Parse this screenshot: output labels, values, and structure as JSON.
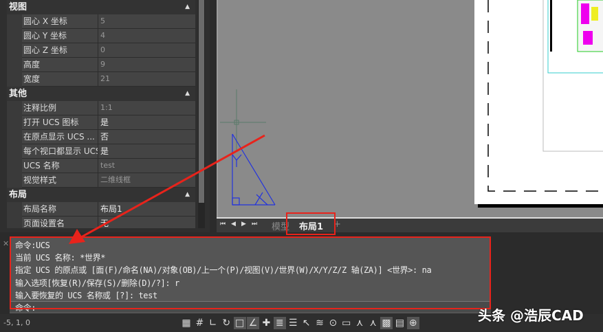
{
  "properties": {
    "sections": [
      {
        "title": "视图",
        "rows": [
          {
            "k": "圆心 X 坐标",
            "v": "5"
          },
          {
            "k": "圆心 Y 坐标",
            "v": "4"
          },
          {
            "k": "圆心 Z 坐标",
            "v": "0"
          },
          {
            "k": "高度",
            "v": "9"
          },
          {
            "k": "宽度",
            "v": "21"
          }
        ]
      },
      {
        "title": "其他",
        "rows": [
          {
            "k": "注释比例",
            "v": "1:1"
          },
          {
            "k": "打开 UCS 图标",
            "v": "是"
          },
          {
            "k": "在原点显示 UCS ...",
            "v": "否"
          },
          {
            "k": "每个视口都显示 UCS",
            "v": "是"
          },
          {
            "k": "UCS 名称",
            "v": "test"
          },
          {
            "k": "视觉样式",
            "v": "二维线框"
          }
        ]
      },
      {
        "title": "布局",
        "rows": [
          {
            "k": "布局名称",
            "v": "布局1"
          },
          {
            "k": "页面设置名",
            "v": "无"
          }
        ]
      }
    ]
  },
  "tabs": {
    "model": "模型",
    "layout1": "布局1",
    "add": "+"
  },
  "command": {
    "lines": [
      "命令:UCS",
      "当前 UCS 名称: *世界*",
      "指定 UCS 的原点或 [面(F)/命名(NA)/对象(OB)/上一个(P)/视图(V)/世界(W)/X/Y/Z/Z 轴(ZA)] <世界>: na",
      "输入选项[恢复(R)/保存(S)/删除(D)/?]: r",
      "输入要恢复的 UCS 名称或 [?]: test"
    ],
    "prompt": "命令:"
  },
  "status": {
    "coords": "-5, 1, 0",
    "icons": [
      "grid-icon",
      "snap-icon",
      "ortho-icon",
      "polar-icon",
      "osnap-icon",
      "otrack-icon",
      "dyn-ucs-icon",
      "lineweight-icon",
      "transparency-icon",
      "selection-cycling-icon",
      "layers-icon",
      "zoom-icon",
      "viewport-icon",
      "annotation-visibility-icon",
      "auto-scale-icon",
      "hardware-accel-icon",
      "properties-icon",
      "isolate-icon"
    ]
  },
  "watermark": "头条 @浩辰CAD",
  "colors": {
    "highlight": "#e8231b",
    "ucs_icon": "#2233dd"
  }
}
